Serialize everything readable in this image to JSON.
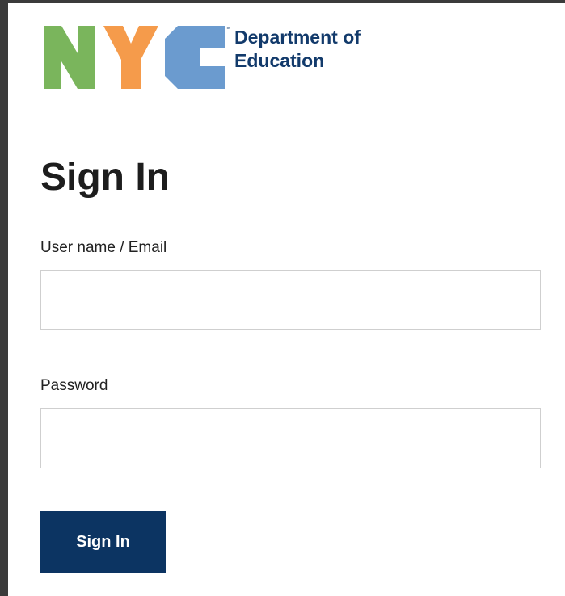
{
  "logo": {
    "letters": "NYC",
    "tm": "™",
    "dept_line1": "Department of",
    "dept_line2": "Education",
    "colors": {
      "n": "#7ab55c",
      "y": "#f59b4b",
      "c": "#6b9bcf",
      "text": "#123a6b"
    }
  },
  "form": {
    "title": "Sign In",
    "username_label": "User name / Email",
    "username_value": "",
    "password_label": "Password",
    "password_value": "",
    "submit_label": "Sign In"
  },
  "colors": {
    "button_bg": "#0c3462",
    "frame": "#3b3b3b"
  }
}
